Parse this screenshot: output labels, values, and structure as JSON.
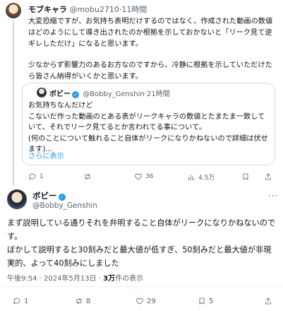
{
  "reply": {
    "display_name": "モブキャラ",
    "handle": "@mobu2710",
    "separator": "·",
    "time": "11時間",
    "paragraphs": [
      "大変恐縮ですが、お気持ち表明だけするのではなく、作成された動画の数値はどのようにして導き出されたのか根拠を示しておかないと「リーク見て逆ギレしただけ」になると思います。",
      "少なからず影響力のあるお方なのですから、冷静に根拠を示していただけたら皆さん納得がいくかと思います。"
    ],
    "quote": {
      "display_name": "ボビー",
      "handle": "@Bobby_Genshin",
      "time": "21時間",
      "text": "お気持ちなんだけど\nこないだ作った動画のとある表がリークキャラの数値とたまたま一致していて、それでリーク見てるとか言われてる事について。\n(何のことについて触れること自体がリークになりかねないので詳細は伏せます)...",
      "show_more": "さらに表示"
    },
    "actions": {
      "reply_count": "1",
      "retweet_count": "",
      "like_count": "36",
      "views": "4.5万"
    }
  },
  "post": {
    "display_name": "ボビー",
    "handle": "@Bobby_Genshin",
    "text": "まず説明している通りそれを弁明すること自体がリークになりかねないのです。\nぼかして説明すると30刻みだと最大値が低すぎ、50刻みだと最大値が非現実的、よって40刻みにしました",
    "time": "午後9:54",
    "date": "2024年5月13日",
    "views_count": "3万",
    "views_label": "件の表示",
    "actions": {
      "reply_count": "1",
      "retweet_count": "8",
      "like_count": "29",
      "bookmark_count": "5"
    }
  }
}
